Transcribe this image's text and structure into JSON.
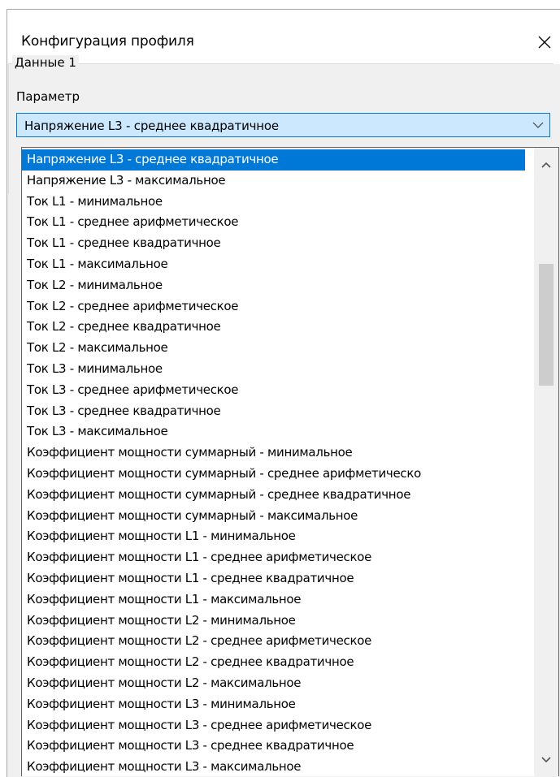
{
  "window": {
    "title": "Конфигурация профиля",
    "close_icon": "close-icon"
  },
  "group": {
    "legend": "Данные 1",
    "parameter_label": "Параметр"
  },
  "combo": {
    "selected_value": "Напряжение L3 - среднее квадратичное",
    "arrow_icon": "chevron-down-icon"
  },
  "dropdown": {
    "selected_index": 0,
    "items": [
      "Напряжение L3 - среднее квадратичное",
      "Напряжение L3 - максимальное",
      "Ток L1 - минимальное",
      "Ток L1 - среднее арифметическое",
      "Ток L1 - среднее квадратичное",
      "Ток L1 - максимальное",
      "Ток L2 - минимальное",
      "Ток L2 - среднее арифметическое",
      "Ток L2 - среднее квадратичное",
      "Ток L2 - максимальное",
      "Ток L3 - минимальное",
      "Ток L3 - среднее арифметическое",
      "Ток L3 - среднее квадратичное",
      "Ток L3 - максимальное",
      "Коэффициент мощности суммарный - минимальное",
      "Коэффициент мощности суммарный - среднее арифметическо",
      "Коэффициент мощности суммарный - среднее квадратичное",
      "Коэффициент мощности суммарный - максимальное",
      "Коэффициент мощности L1 - минимальное",
      "Коэффициент мощности L1 - среднее арифметическое",
      "Коэффициент мощности L1 - среднее квадратичное",
      "Коэффициент мощности L1 - максимальное",
      "Коэффициент мощности L2 - минимальное",
      "Коэффициент мощности L2 - среднее арифметическое",
      "Коэффициент мощности L2 - среднее квадратичное",
      "Коэффициент мощности L2 - максимальное",
      "Коэффициент мощности L3 - минимальное",
      "Коэффициент мощности L3 - среднее арифметическое",
      "Коэффициент мощности L3 - среднее квадратичное",
      "Коэффициент мощности L3 - максимальное"
    ],
    "scrollbar": {
      "up_icon": "scroll-up-arrow-icon",
      "down_icon": "scroll-down-arrow-icon"
    }
  },
  "colors": {
    "selection": "#0078d7",
    "combo_focus_bg": "#cce8ff",
    "dialog_bg": "#f0f0f0"
  }
}
